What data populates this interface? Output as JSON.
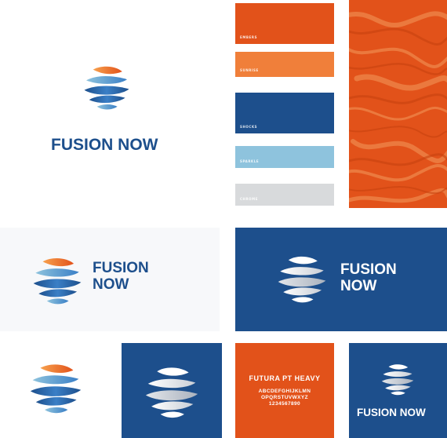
{
  "brand": {
    "name": "FUSION NOW",
    "name_line1": "FUSION",
    "name_line2": "NOW"
  },
  "colors": {
    "orange": "#E2521A",
    "light_orange": "#F07F3A",
    "navy": "#1D4F8C",
    "light_blue": "#8EC3DD",
    "light_gray": "#D8DADC",
    "wordmark_blue": "#1D4F8C"
  },
  "palette": [
    {
      "label": "EMBERS"
    },
    {
      "label": "SUNRISE"
    },
    {
      "label": "SHOCKS"
    },
    {
      "label": "SPARKLE"
    },
    {
      "label": "CHROME"
    }
  ],
  "typography": {
    "font_name": "FUTURA PT HEAVY",
    "alphabet_line1": "ABCDEFGHIJKLMN",
    "alphabet_line2": "OPQRSTUVWXYZ",
    "numerals": "1234567890"
  },
  "icons": [
    "fusion-globe-icon",
    "marble-texture"
  ]
}
